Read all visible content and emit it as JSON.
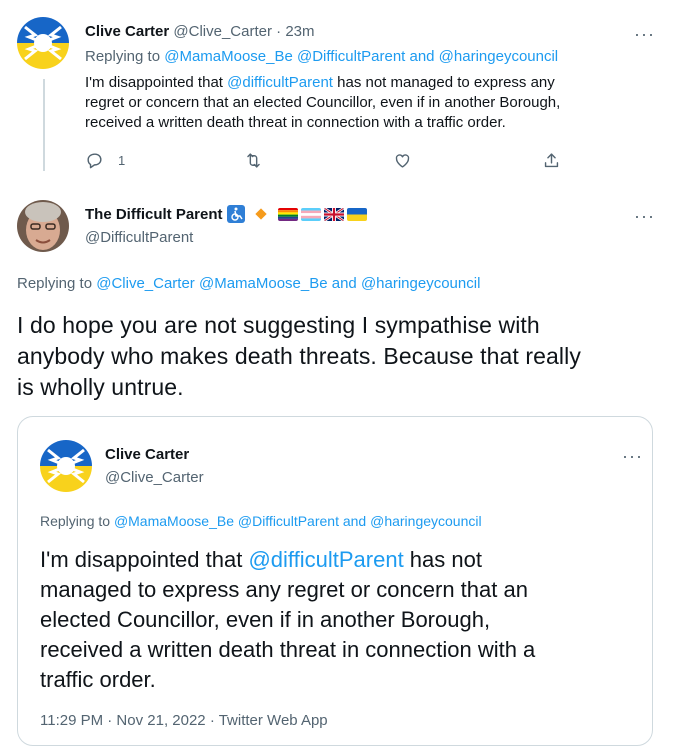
{
  "tweet1": {
    "name": "Clive Carter",
    "handle": "@Clive_Carter",
    "sep": "·",
    "time": "23m",
    "replying_prefix": "Replying to",
    "replying_mentions": "@MamaMoose_Be @DifficultParent and @haringeycouncil",
    "text_before": "I'm disappointed that ",
    "text_mention": "@difficultParent",
    "text_line1_after": " has not managed to express any",
    "text_line2": "regret or concern that an elected Councillor, even if in another Borough,",
    "text_line3": "received a written death threat in connection with a traffic order.",
    "reply_count": "1",
    "more": "···"
  },
  "tweet2": {
    "name": "The Difficult Parent",
    "handle": "@DifficultParent",
    "more": "···",
    "replying_prefix": "Replying to",
    "replying_mentions": "@Clive_Carter @MamaMoose_Be and @haringeycouncil",
    "text_line1": "I do hope you are not suggesting I sympathise with",
    "text_line2": "anybody who makes death threats. Because that really",
    "text_line3": "is wholly untrue."
  },
  "quoted": {
    "name": "Clive Carter",
    "handle": "@Clive_Carter",
    "more": "···",
    "replying_prefix": "Replying to",
    "replying_mentions": "@MamaMoose_Be @DifficultParent and @haringeycouncil",
    "text_before": "I'm disappointed that ",
    "text_mention": "@difficultParent",
    "text_line1_after": " has not",
    "text_line2": "managed to express any regret or concern that an",
    "text_line3": "elected Councillor, even if in another Borough,",
    "text_line4": "received a written death threat in connection with a",
    "text_line5": "traffic order.",
    "timestamp": "11:29 PM · Nov 21, 2022 · Twitter Web App"
  },
  "icons": [
    "reply-icon",
    "retweet-icon",
    "like-icon",
    "share-icon",
    "wheelchair-icon",
    "diamond-icon",
    "rainbow-flag-icon",
    "trans-flag-icon",
    "uk-flag-icon",
    "ukraine-flag-icon"
  ],
  "colors": {
    "accent": "#1d9bf0",
    "muted": "#536471",
    "border": "#cfd9de",
    "text": "#0f1419",
    "ukraine_blue": "#1766c7",
    "ukraine_yellow": "#f8d21c"
  }
}
